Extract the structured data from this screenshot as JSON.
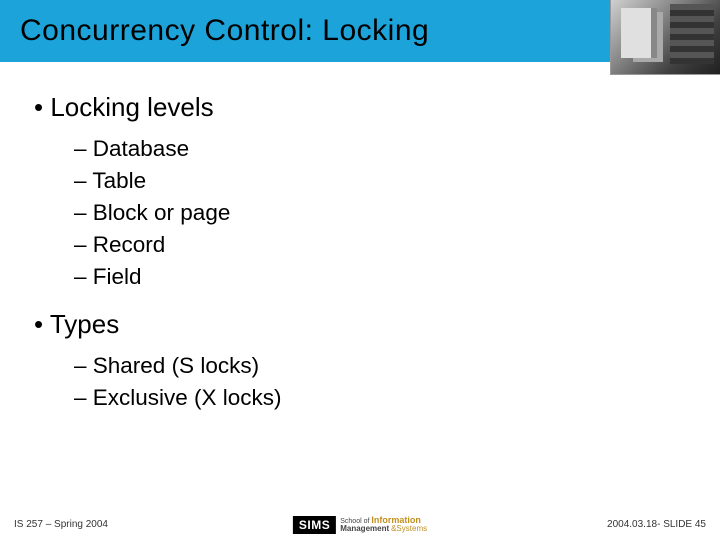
{
  "title": "Concurrency Control: Locking",
  "bullets": {
    "levels_label": "• Locking levels",
    "levels": {
      "i0": "– Database",
      "i1": "– Table",
      "i2": "– Block or page",
      "i3": "– Record",
      "i4": "– Field"
    },
    "types_label": "• Types",
    "types": {
      "i0": "– Shared (S locks)",
      "i1": "– Exclusive (X locks)"
    }
  },
  "footer": {
    "left": "IS 257 – Spring 2004",
    "right": "2004.03.18- SLIDE 45",
    "logo": "SIMS",
    "school_of": "School of",
    "information": "Information",
    "management": "Management",
    "and_systems": "&Systems"
  }
}
